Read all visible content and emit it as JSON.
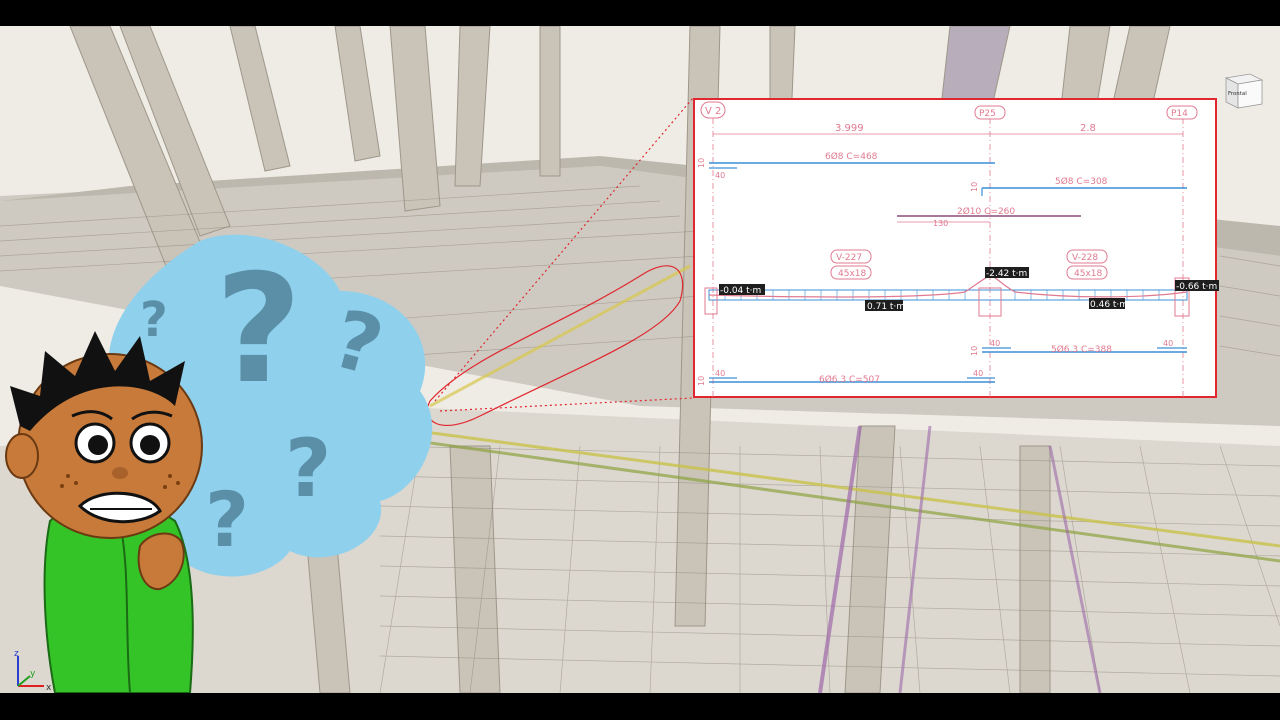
{
  "viewcube": {
    "face_label": "Frontal"
  },
  "axes": {
    "z": "z",
    "y": "y",
    "x": "x"
  },
  "detail": {
    "gridlines": {
      "left": "V 2",
      "middle": "P25",
      "right": "P14"
    },
    "spans": {
      "left": "3.999",
      "right": "2.8"
    },
    "bars": {
      "top_long": "6Ø8  C=468",
      "top_right": "5Ø8  C=308",
      "mid": "2Ø10  C=260",
      "bottom_right": "5Ø6.3  C=388",
      "bottom_long": "6Ø6.3  C=507"
    },
    "dims": {
      "d40": "40",
      "d10": "10",
      "d130": "130"
    },
    "beams": [
      {
        "name": "V-227",
        "section": "45x18"
      },
      {
        "name": "V-228",
        "section": "45x18"
      }
    ],
    "moments": {
      "left_end": "-0.04 t·m",
      "left_mid": "0.71 t·m",
      "support": "-2.42 t·m",
      "right_mid": "0.46 t·m",
      "right_end": "-0.66 t·m"
    }
  },
  "colors": {
    "frame": "#e0262e",
    "rebar_blue": "#3c8fd8",
    "label_pink": "#e07a90",
    "cloud": "#8fd0ec",
    "question": "#5b8fa8",
    "shirt": "#35c427",
    "skin": "#c77a3a"
  }
}
